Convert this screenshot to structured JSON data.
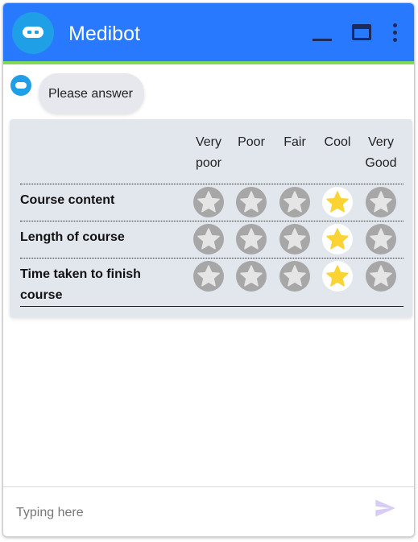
{
  "header": {
    "title": "Medibot",
    "accent": "#2979ff",
    "underline": "#7ed957",
    "icons": [
      "robot-icon",
      "minimize-icon",
      "maximize-icon",
      "more-vert-icon"
    ]
  },
  "chat": {
    "message": "Please answer"
  },
  "rating": {
    "columns": [
      "Very poor",
      "Poor",
      "Fair",
      "Cool",
      "Very Good"
    ],
    "column_lines": [
      [
        "Very",
        "poor"
      ],
      [
        "Poor"
      ],
      [
        "Fair"
      ],
      [
        "Cool"
      ],
      [
        "Very",
        "Good"
      ]
    ],
    "rows": [
      {
        "label": "Course content",
        "label_lines": [
          "Course content"
        ],
        "selected": "Cool"
      },
      {
        "label": "Length of course",
        "label_lines": [
          "Length of course"
        ],
        "selected": "Cool"
      },
      {
        "label": "Time taken to finish course",
        "label_lines": [
          "Time taken to finish",
          "course"
        ],
        "selected": "Cool"
      }
    ],
    "star_selected_color": "#fbd335",
    "star_unselected_color": "#e5e5e5"
  },
  "composer": {
    "placeholder": "Typing here"
  }
}
